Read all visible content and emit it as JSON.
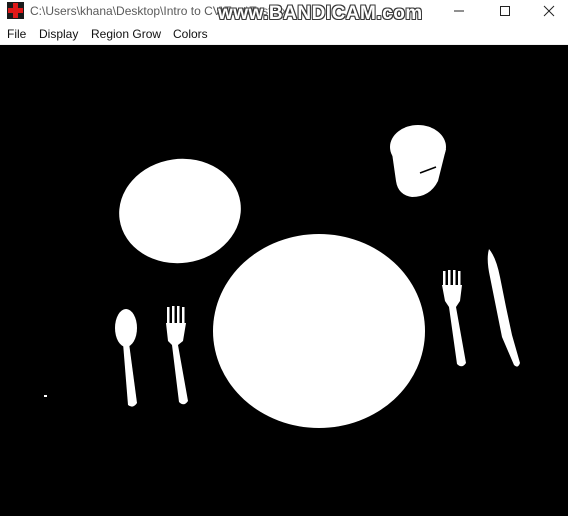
{
  "window": {
    "title": "C:\\Users\\khana\\Desktop\\Intro to CV\\Test\\Test.exe",
    "watermark": "www.BANDICAM.com",
    "app_icon": "red-cross-app-icon",
    "controls": {
      "minimize_icon": "minimize-icon",
      "maximize_icon": "maximize-icon",
      "close_icon": "close-icon"
    }
  },
  "menu": {
    "items": [
      "File",
      "Display",
      "Region Grow",
      "Colors"
    ]
  },
  "canvas": {
    "background": "#000000",
    "foreground": "#ffffff",
    "content": "binary segmentation mask of a table setting"
  }
}
